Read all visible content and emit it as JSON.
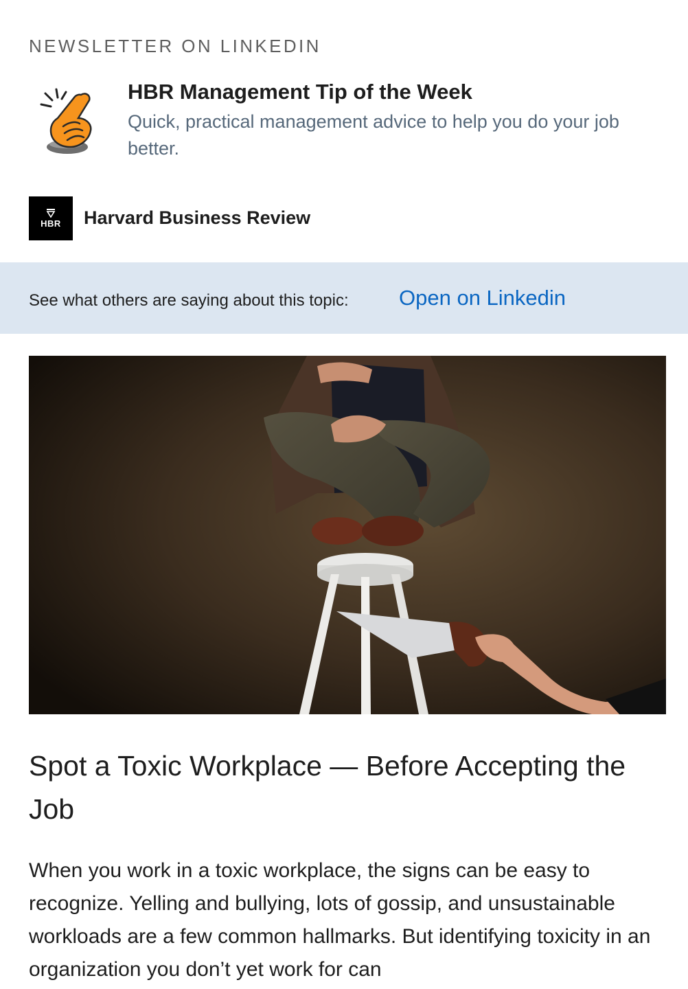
{
  "eyebrow": "NEWSLETTER ON LINKEDIN",
  "newsletter": {
    "icon": "pointing-hand-icon",
    "title": "HBR Management Tip of the Week",
    "description": "Quick, practical management advice to help you do your job better."
  },
  "publisher": {
    "logo_text": "HBR",
    "name": "Harvard Business Review"
  },
  "banner": {
    "text": "See what others are saying about this topic:",
    "link_label": "Open on Linkedin"
  },
  "article": {
    "hero_image": "person-on-stool-being-sawed-image",
    "title": "Spot a Toxic Workplace — Before Accepting the Job",
    "body": "When you work in a toxic workplace, the signs can be easy to recognize. Yelling and bullying, lots of gossip, and unsustainable workloads are a few common hallmarks. But identifying toxicity in an organization you don’t yet work for can"
  },
  "colors": {
    "link": "#0a66c2",
    "banner_bg": "#dce6f1",
    "subtle_text": "#56687a",
    "eyebrow_text": "#5e5e5e",
    "hand_orange": "#f7941d"
  }
}
